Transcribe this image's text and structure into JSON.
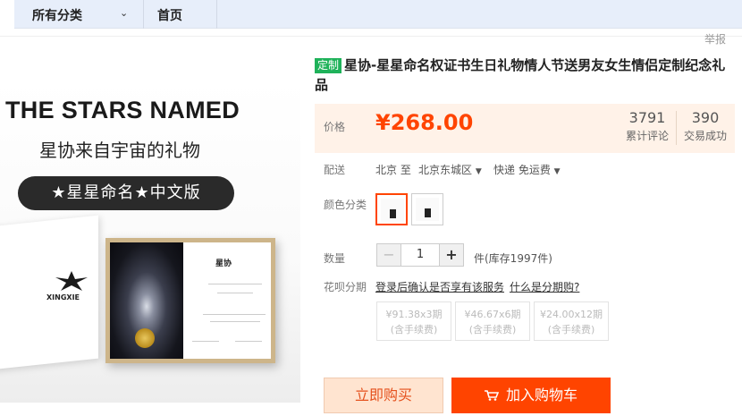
{
  "nav": {
    "category_label": "所有分类",
    "home_label": "首页"
  },
  "report_label": "举报",
  "product_image": {
    "headline": "THE STARS NAMED",
    "subline": "星协来自宇宙的礼物",
    "pill": "★星星命名★中文版",
    "brand": "XINGXIE",
    "cert_title": "星协"
  },
  "product": {
    "tag": "定制",
    "title": "星协-星星命名权证书生日礼物情人节送男友女生情侣定制纪念礼品"
  },
  "price": {
    "label": "价格",
    "value": "¥268.00",
    "reviews_count": "3791",
    "reviews_label": "累计评论",
    "sales_count": "390",
    "sales_label": "交易成功"
  },
  "delivery": {
    "label": "配送",
    "from": "北京 至",
    "to": "北京东城区",
    "shipping": "快递 免运费"
  },
  "color": {
    "label": "颜色分类"
  },
  "quantity": {
    "label": "数量",
    "value": "1",
    "stock": "件(库存1997件)"
  },
  "installment": {
    "label": "花呗分期",
    "hint": "登录后确认是否享有该服务",
    "link": "什么是分期购?",
    "options": [
      {
        "amount": "¥91.38x3期",
        "fee": "(含手续费)"
      },
      {
        "amount": "¥46.67x6期",
        "fee": "(含手续费)"
      },
      {
        "amount": "¥24.00x12期",
        "fee": "(含手续费)"
      }
    ]
  },
  "actions": {
    "buy_now": "立即购买",
    "add_to_cart": "加入购物车"
  },
  "colors": {
    "accent": "#ff4400",
    "price_bg": "#fff2e8",
    "tag_green": "#1fb25a",
    "nav_bg": "#e7eefa"
  }
}
